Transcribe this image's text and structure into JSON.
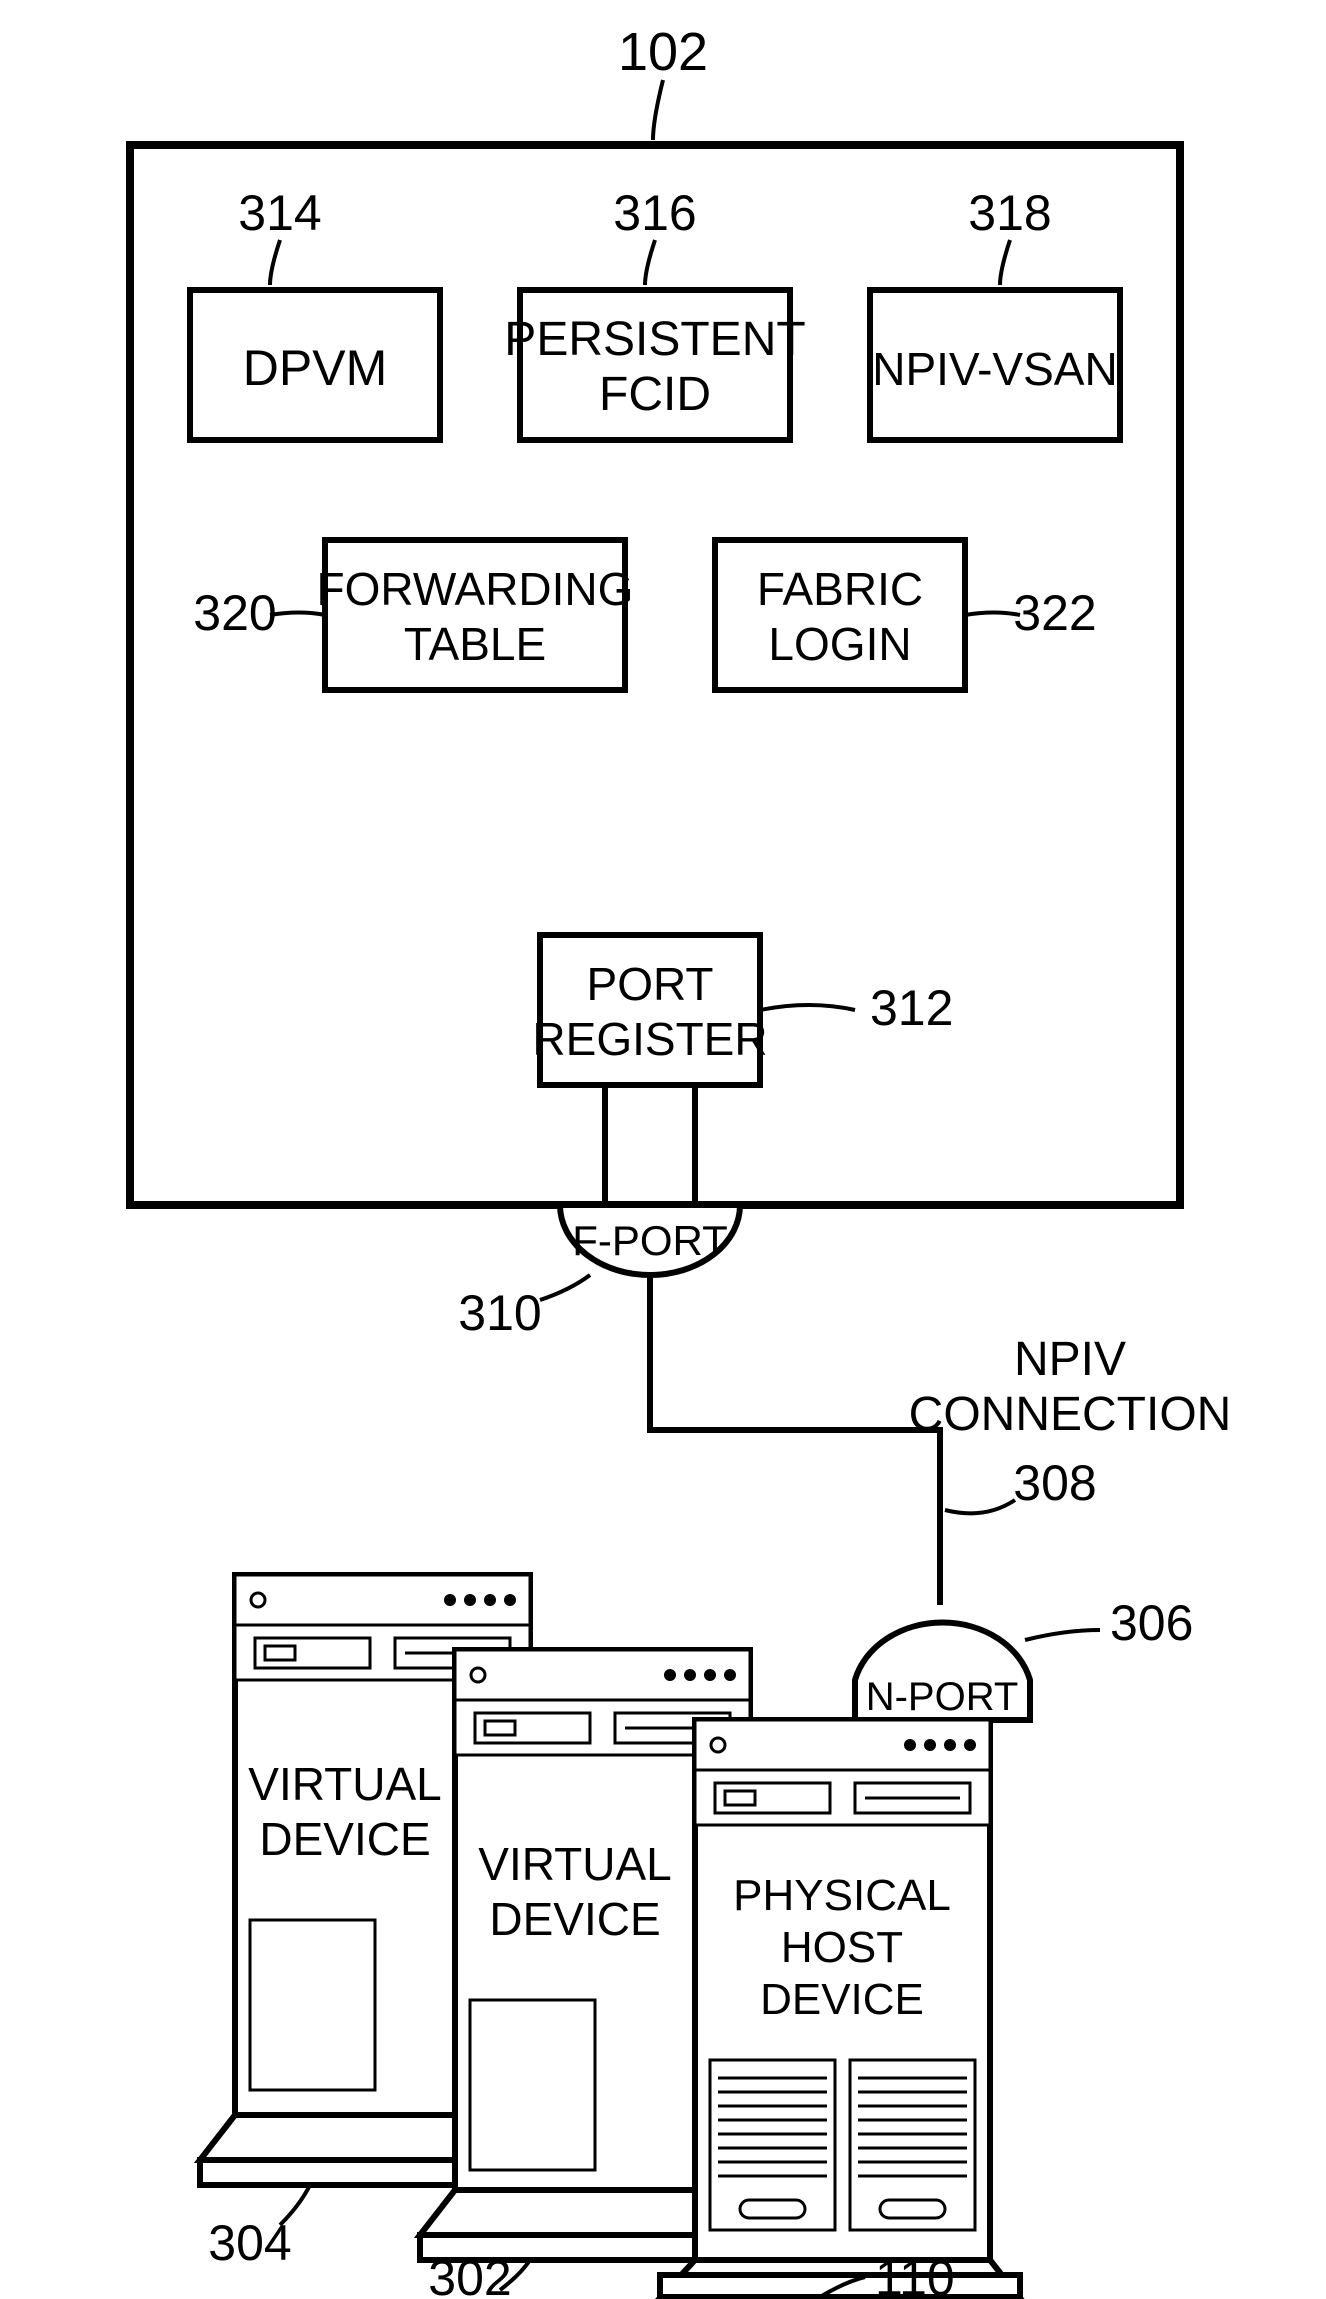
{
  "refs": {
    "switch": "102",
    "dpvm": "314",
    "pfcid": "316",
    "npiv_vsan": "318",
    "fwd_table": "320",
    "fabric_login": "322",
    "port_reg": "312",
    "fport": "310",
    "npiv_conn": "308",
    "nport": "306",
    "phys_host": "110",
    "vdev2": "302",
    "vdev1": "304"
  },
  "labels": {
    "dpvm": "DPVM",
    "pfcid_l1": "PERSISTENT",
    "pfcid_l2": "FCID",
    "npiv_vsan": "NPIV-VSAN",
    "fwd_l1": "FORWARDING",
    "fwd_l2": "TABLE",
    "fab_l1": "FABRIC",
    "fab_l2": "LOGIN",
    "preg_l1": "PORT",
    "preg_l2": "REGISTER",
    "fport": "F-PORT",
    "nport": "N-PORT",
    "npiv_conn_l1": "NPIV",
    "npiv_conn_l2": "CONNECTION",
    "vdev_l1": "VIRTUAL",
    "vdev_l2": "DEVICE",
    "phys_l1": "PHYSICAL",
    "phys_l2": "HOST",
    "phys_l3": "DEVICE"
  }
}
